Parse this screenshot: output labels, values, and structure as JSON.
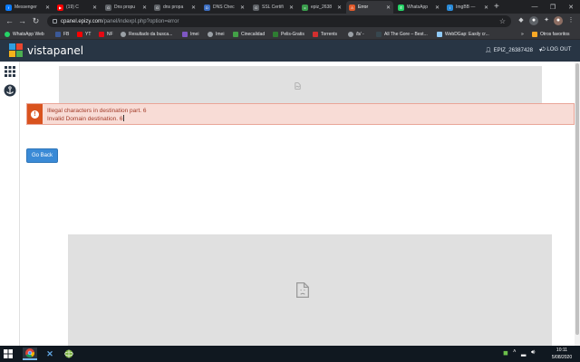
{
  "browser": {
    "tabs": [
      {
        "title": "Messenger",
        "color": "#0a7cff",
        "glyph": "f"
      },
      {
        "title": "(19) C",
        "color": "#ff0000",
        "glyph": "▶"
      },
      {
        "title": "Dns propu",
        "color": "#5f6368",
        "glyph": "G"
      },
      {
        "title": "dns propa",
        "color": "#5f6368",
        "glyph": "G"
      },
      {
        "title": "DNS Chec",
        "color": "#3c6ec2",
        "glyph": "D"
      },
      {
        "title": "SSL Certifi",
        "color": "#5f6368",
        "glyph": "G"
      },
      {
        "title": "epiz_2638",
        "color": "#3a9d4c",
        "glyph": "c"
      },
      {
        "title": "Error",
        "color": "#e05a2b",
        "glyph": "⚠"
      },
      {
        "title": "WhatsApp",
        "color": "#25d366",
        "glyph": "✆"
      },
      {
        "title": "ImgBB —",
        "color": "#2a8bd9",
        "glyph": "I"
      }
    ],
    "url_host": "cpanel.epizy.com",
    "url_path": "/panel/indexpl.php?option=error",
    "bookmarks": [
      {
        "label": "WhatsApp Web",
        "color": "#25d366"
      },
      {
        "label": "FB",
        "color": "#3b5998"
      },
      {
        "label": "YT",
        "color": "#ff0000"
      },
      {
        "label": "NF",
        "color": "#e50914"
      },
      {
        "label": "Resultado da busca...",
        "color": "#9aa0a6"
      },
      {
        "label": "Imei",
        "color": "#7e57c2"
      },
      {
        "label": "Imei",
        "color": "#9aa0a6"
      },
      {
        "label": "Cinecalidad",
        "color": "#43a047"
      },
      {
        "label": "Pelis-Gratis",
        "color": "#2e7d32"
      },
      {
        "label": "Torrents",
        "color": "#d32f2f"
      },
      {
        "label": "/b/ -",
        "color": "#9aa0a6"
      },
      {
        "label": "All The Gore – Best...",
        "color": "#37474f"
      },
      {
        "label": "WebDGap: Easily cr...",
        "color": "#90caf9"
      },
      {
        "label": "Otros favoritos",
        "color": "#f9a825"
      }
    ],
    "more_bookmarks": "»"
  },
  "vistapanel": {
    "logo_text": "vistapanel",
    "username": "EPIZ_26387428",
    "logout_label": "LOG OUT"
  },
  "alert": {
    "line1": "Illegal characters in destination part. 6",
    "line2": "Invalid Domain destination. 6"
  },
  "go_back_label": "Go Back",
  "taskbar": {
    "time": "10:11",
    "date": "5/08/2020"
  }
}
